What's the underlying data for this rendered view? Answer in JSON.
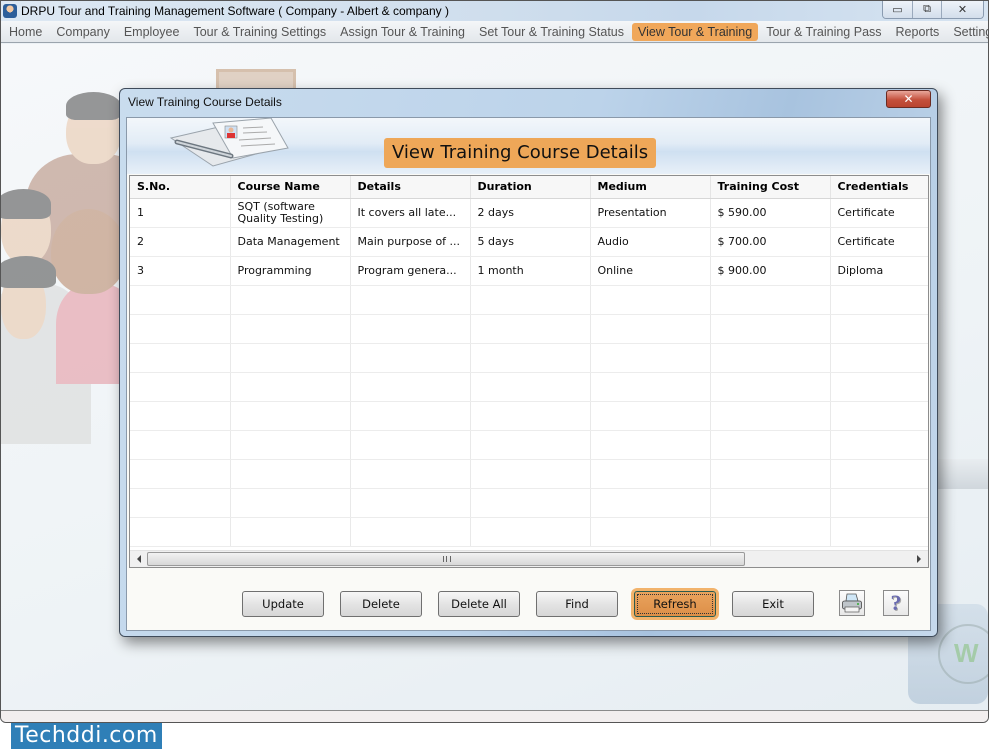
{
  "app": {
    "title": "DRPU Tour and Training Management Software ( Company - Albert & company )",
    "window_controls": {
      "minimize": "▭",
      "restore": "⧉",
      "close": "✕"
    }
  },
  "menu": {
    "items": [
      {
        "label": "Home",
        "active": false
      },
      {
        "label": "Company",
        "active": false
      },
      {
        "label": "Employee",
        "active": false
      },
      {
        "label": "Tour & Training Settings",
        "active": false
      },
      {
        "label": "Assign Tour & Training",
        "active": false
      },
      {
        "label": "Set Tour & Training Status",
        "active": false
      },
      {
        "label": "View Tour & Training",
        "active": true
      },
      {
        "label": "Tour & Training Pass",
        "active": false
      },
      {
        "label": "Reports",
        "active": false
      },
      {
        "label": "Settings",
        "active": false
      }
    ],
    "active_color": "#f0a75a"
  },
  "dialog": {
    "title": "View Training Course Details",
    "close_glyph": "✕",
    "banner_title": "View Training Course Details",
    "banner_color": "#eea758"
  },
  "grid": {
    "columns": [
      "S.No.",
      "Course Name",
      "Details",
      "Duration",
      "Medium",
      "Training Cost",
      "Credentials"
    ],
    "rows": [
      [
        "1",
        "SQT (software Quality Testing)",
        "It covers all late...",
        "2 days",
        "Presentation",
        "$ 590.00",
        "Certificate"
      ],
      [
        "2",
        "Data Management",
        "Main purpose of ...",
        "5 days",
        "Audio",
        "$ 700.00",
        "Certificate"
      ],
      [
        "3",
        "Programming",
        "Program genera...",
        "1 month",
        "Online",
        "$ 900.00",
        "Diploma"
      ]
    ],
    "empty_rows": 9
  },
  "buttons": {
    "update": "Update",
    "delete": "Delete",
    "delete_all": "Delete All",
    "find": "Find",
    "refresh": "Refresh",
    "exit": "Exit",
    "help_glyph": "?"
  },
  "watermark": "Techddi.com"
}
